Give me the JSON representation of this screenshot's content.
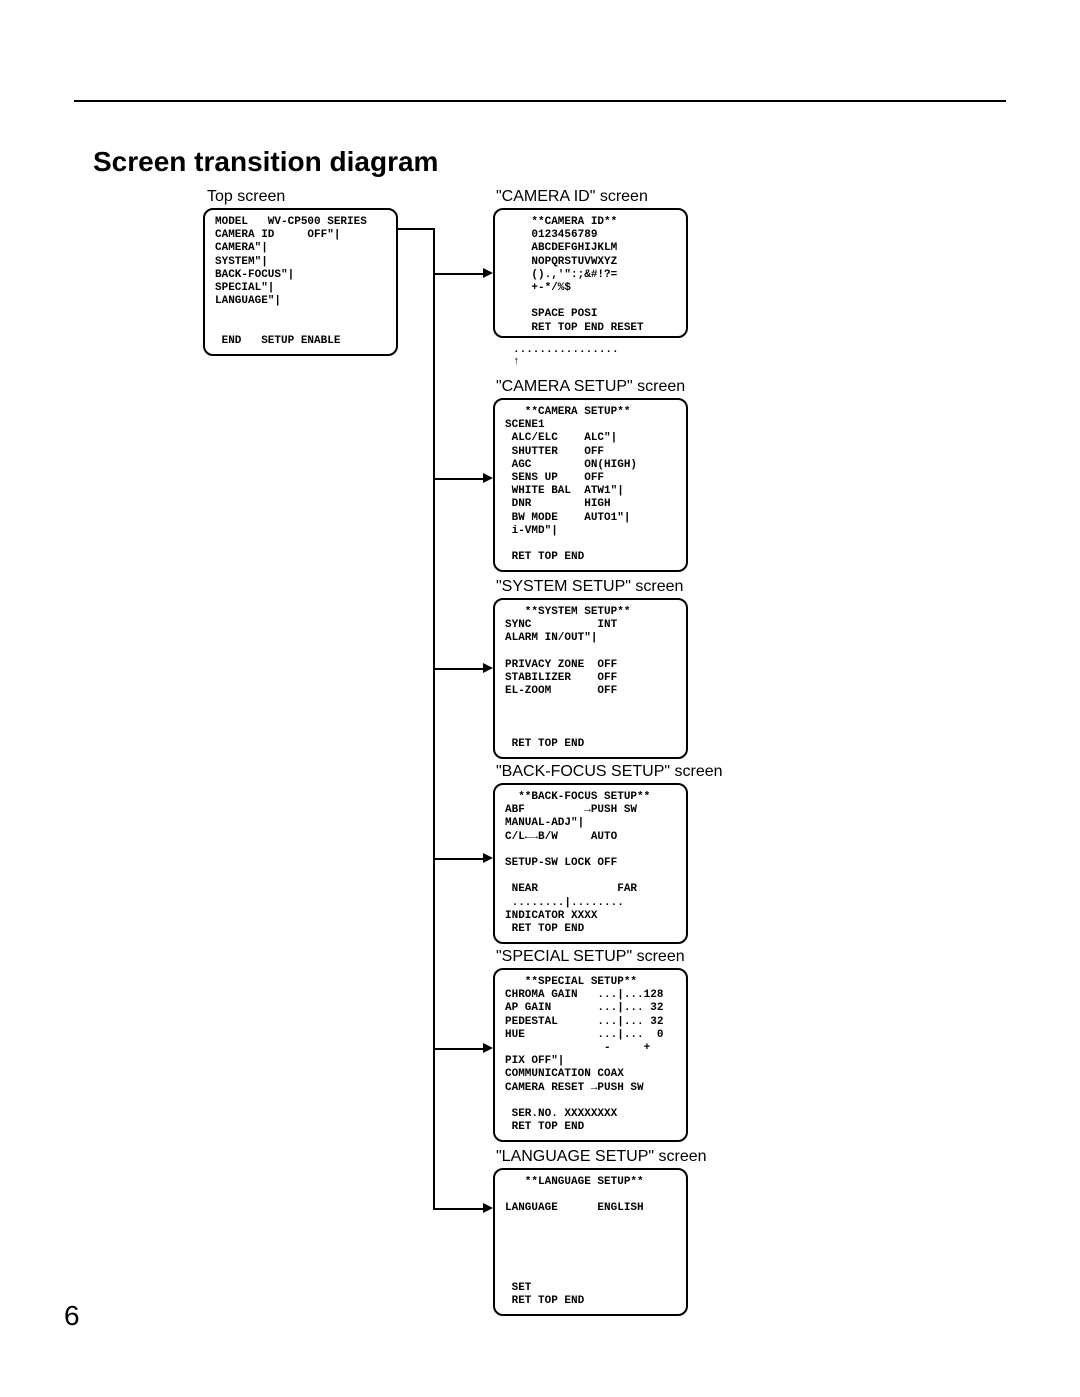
{
  "title": "Screen transition diagram",
  "pageNumber": "6",
  "labels": {
    "top": "Top screen",
    "cameraId": "\"CAMERA ID\" screen",
    "cameraSetup": "\"CAMERA SETUP\" screen",
    "systemSetup": "\"SYSTEM SETUP\" screen",
    "backFocus": "\"BACK-FOCUS SETUP\" screen",
    "special": "\"SPECIAL SETUP\" screen",
    "language": "\"LANGUAGE SETUP\" screen"
  },
  "panels": {
    "top": "MODEL   WV-CP500 SERIES\nCAMERA ID     OFF\"|\nCAMERA\"|\nSYSTEM\"|\nBACK-FOCUS\"|\nSPECIAL\"|\nLANGUAGE\"|\n\n\n END   SETUP ENABLE",
    "cameraId": "    **CAMERA ID**\n    0123456789\n    ABCDEFGHIJKLM\n    NOPQRSTUVWXYZ\n    ().,'\":;&#!?=\n    +-*/%$\n\n    SPACE POSI\n    RET TOP END RESET",
    "cameraIdSub": "................\n↑",
    "cameraSetup": "   **CAMERA SETUP**\nSCENE1\n ALC/ELC    ALC\"|\n SHUTTER    OFF\n AGC        ON(HIGH)\n SENS UP    OFF\n WHITE BAL  ATW1\"|\n DNR        HIGH\n BW MODE    AUTO1\"|\n i-VMD\"|\n\n RET TOP END",
    "systemSetup": "   **SYSTEM SETUP**\nSYNC          INT\nALARM IN/OUT\"|\n\nPRIVACY ZONE  OFF\nSTABILIZER    OFF\nEL-ZOOM       OFF\n\n\n\n RET TOP END",
    "backFocus": "  **BACK-FOCUS SETUP**\nABF         →PUSH SW\nMANUAL-ADJ\"|\nC/L←→B/W     AUTO\n\nSETUP-SW LOCK OFF\n\n NEAR            FAR\n ........|........\nINDICATOR XXXX\n RET TOP END",
    "special": "   **SPECIAL SETUP**\nCHROMA GAIN   ...|...128\nAP GAIN       ...|... 32\nPEDESTAL      ...|... 32\nHUE           ...|...  0\n               -     +\nPIX OFF\"|\nCOMMUNICATION COAX\nCAMERA RESET →PUSH SW\n\n SER.NO. XXXXXXXX\n RET TOP END",
    "language": "   **LANGUAGE SETUP**\n\nLANGUAGE      ENGLISH\n\n\n\n\n\n SET\n RET TOP END"
  }
}
